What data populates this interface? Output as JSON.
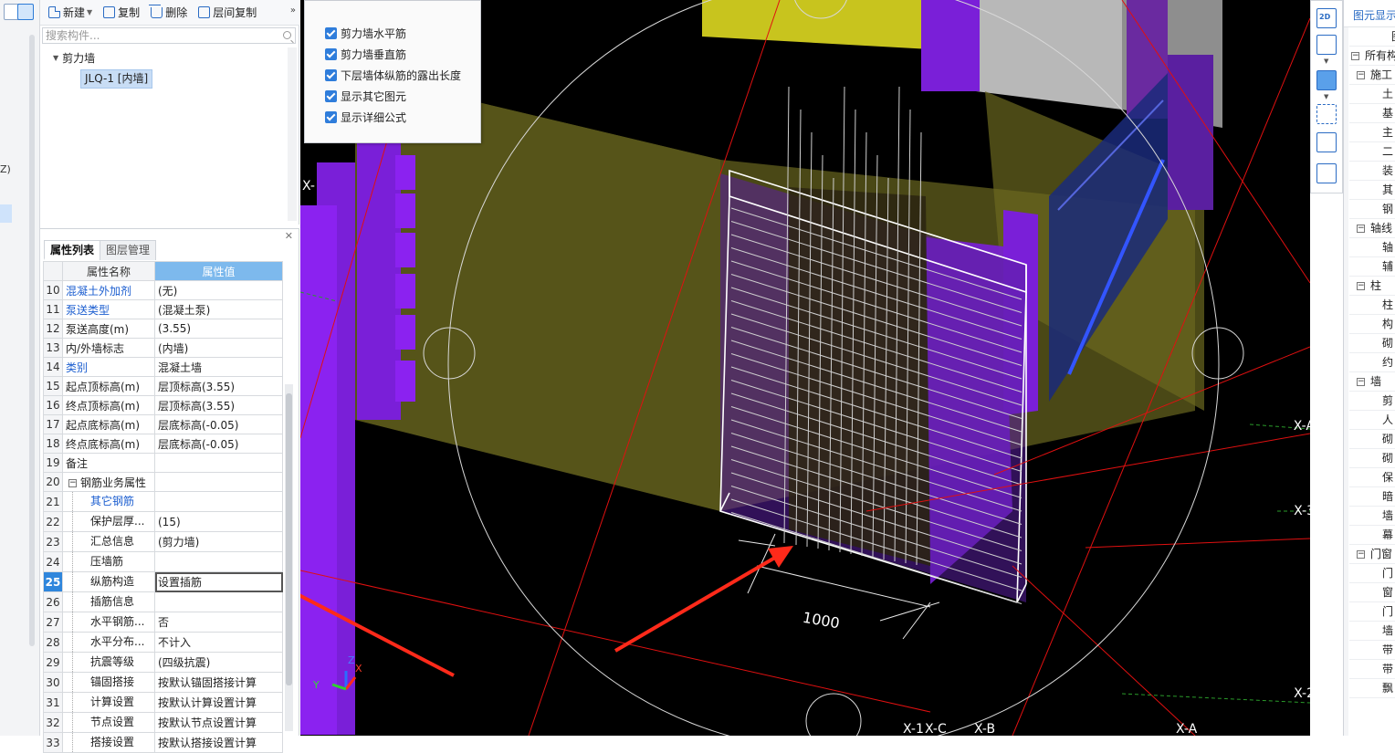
{
  "left_strip": {
    "label": "Z)"
  },
  "toolbar": {
    "new_label": "新建",
    "copy_label": "复制",
    "delete_label": "删除",
    "floor_copy_label": "层间复制",
    "more": "»"
  },
  "search": {
    "placeholder": "搜索构件..."
  },
  "tree": {
    "root_label": "剪力墙",
    "selected_item": "JLQ-1 [内墙]"
  },
  "prop_panel": {
    "tabs": [
      "属性列表",
      "图层管理"
    ],
    "col_name": "属性名称",
    "col_value": "属性值",
    "rows": [
      {
        "num": "10",
        "name": "混凝土外加剂",
        "value": "(无)",
        "blue": true
      },
      {
        "num": "11",
        "name": "泵送类型",
        "value": "(混凝土泵)",
        "blue": true
      },
      {
        "num": "12",
        "name": "泵送高度(m)",
        "value": "(3.55)"
      },
      {
        "num": "13",
        "name": "内/外墙标志",
        "value": "(内墙)"
      },
      {
        "num": "14",
        "name": "类别",
        "value": "混凝土墙",
        "blue": true
      },
      {
        "num": "15",
        "name": "起点顶标高(m)",
        "value": "层顶标高(3.55)"
      },
      {
        "num": "16",
        "name": "终点顶标高(m)",
        "value": "层顶标高(3.55)"
      },
      {
        "num": "17",
        "name": "起点底标高(m)",
        "value": "层底标高(-0.05)"
      },
      {
        "num": "18",
        "name": "终点底标高(m)",
        "value": "层底标高(-0.05)"
      },
      {
        "num": "19",
        "name": "备注",
        "value": ""
      },
      {
        "num": "20",
        "name": "钢筋业务属性",
        "value": "",
        "group": true
      },
      {
        "num": "21",
        "name": "其它钢筋",
        "value": "",
        "child": true,
        "blue": true
      },
      {
        "num": "22",
        "name": "保护层厚...",
        "value": "(15)",
        "child": true
      },
      {
        "num": "23",
        "name": "汇总信息",
        "value": "(剪力墙)",
        "child": true
      },
      {
        "num": "24",
        "name": "压墙筋",
        "value": "",
        "child": true
      },
      {
        "num": "25",
        "name": "纵筋构造",
        "value": "设置插筋",
        "child": true,
        "highlight": true
      },
      {
        "num": "26",
        "name": "插筋信息",
        "value": "",
        "child": true
      },
      {
        "num": "27",
        "name": "水平钢筋...",
        "value": "否",
        "child": true
      },
      {
        "num": "28",
        "name": "水平分布...",
        "value": "不计入",
        "child": true
      },
      {
        "num": "29",
        "name": "抗震等级",
        "value": "(四级抗震)",
        "child": true
      },
      {
        "num": "30",
        "name": "锚固搭接",
        "value": "按默认锚固搭接计算",
        "child": true
      },
      {
        "num": "31",
        "name": "计算设置",
        "value": "按默认计算设置计算",
        "child": true
      },
      {
        "num": "32",
        "name": "节点设置",
        "value": "按默认节点设置计算",
        "child": true
      },
      {
        "num": "33",
        "name": "搭接设置",
        "value": "按默认搭接设置计算",
        "child": true
      }
    ]
  },
  "view_options": {
    "items": [
      "剪力墙水平筋",
      "剪力墙垂直筋",
      "下层墙体纵筋的露出长度",
      "显示其它图元",
      "显示详细公式"
    ],
    "checked": [
      true,
      true,
      true,
      true,
      true
    ]
  },
  "viewport": {
    "dimension_label": "1000",
    "axis_labels": [
      "X-",
      "X-A",
      "X-3",
      "X-2",
      "X-1",
      "X-C",
      "X-B",
      "X-A"
    ],
    "gizmo": {
      "x": "X",
      "y": "Y",
      "z": "Z"
    }
  },
  "right_tools": {
    "two_d": "2D"
  },
  "right_panel": {
    "title": "图元显示",
    "rows": [
      {
        "text": "图",
        "kind": "hd"
      },
      {
        "text": "所有构",
        "kind": "top",
        "minus": true
      },
      {
        "text": "施工",
        "kind": "l0",
        "minus": true
      },
      {
        "text": "土",
        "kind": "l1"
      },
      {
        "text": "基",
        "kind": "l1"
      },
      {
        "text": "主",
        "kind": "l1"
      },
      {
        "text": "二",
        "kind": "l1"
      },
      {
        "text": "装",
        "kind": "l1"
      },
      {
        "text": "其",
        "kind": "l1"
      },
      {
        "text": "钢",
        "kind": "l1"
      },
      {
        "text": "轴线",
        "kind": "l0",
        "minus": true
      },
      {
        "text": "轴",
        "kind": "l1"
      },
      {
        "text": "辅",
        "kind": "l1"
      },
      {
        "text": "柱",
        "kind": "l0",
        "minus": true
      },
      {
        "text": "柱",
        "kind": "l1"
      },
      {
        "text": "构",
        "kind": "l1"
      },
      {
        "text": "砌",
        "kind": "l1"
      },
      {
        "text": "约",
        "kind": "l1"
      },
      {
        "text": "墙",
        "kind": "l0",
        "minus": true
      },
      {
        "text": "剪",
        "kind": "l1"
      },
      {
        "text": "人",
        "kind": "l1"
      },
      {
        "text": "砌",
        "kind": "l1"
      },
      {
        "text": "砌",
        "kind": "l1"
      },
      {
        "text": "保",
        "kind": "l1"
      },
      {
        "text": "暗",
        "kind": "l1"
      },
      {
        "text": "墙",
        "kind": "l1"
      },
      {
        "text": "幕",
        "kind": "l1"
      },
      {
        "text": "门窗",
        "kind": "l0",
        "minus": true
      },
      {
        "text": "门",
        "kind": "l1"
      },
      {
        "text": "窗",
        "kind": "l1"
      },
      {
        "text": "门",
        "kind": "l1"
      },
      {
        "text": "墙",
        "kind": "l1"
      },
      {
        "text": "带",
        "kind": "l1"
      },
      {
        "text": "带",
        "kind": "l1"
      },
      {
        "text": "飘",
        "kind": "l1"
      }
    ]
  },
  "colors": {
    "viewport_bg": "#000000",
    "wall_purple": "#7a1fd8",
    "wall_olive": "#5c5a1c",
    "yellow_top": "#c8c41e",
    "axis_red": "#e01010",
    "accent_blue": "#2f86dc",
    "arrow_red": "#ff2a1a"
  }
}
